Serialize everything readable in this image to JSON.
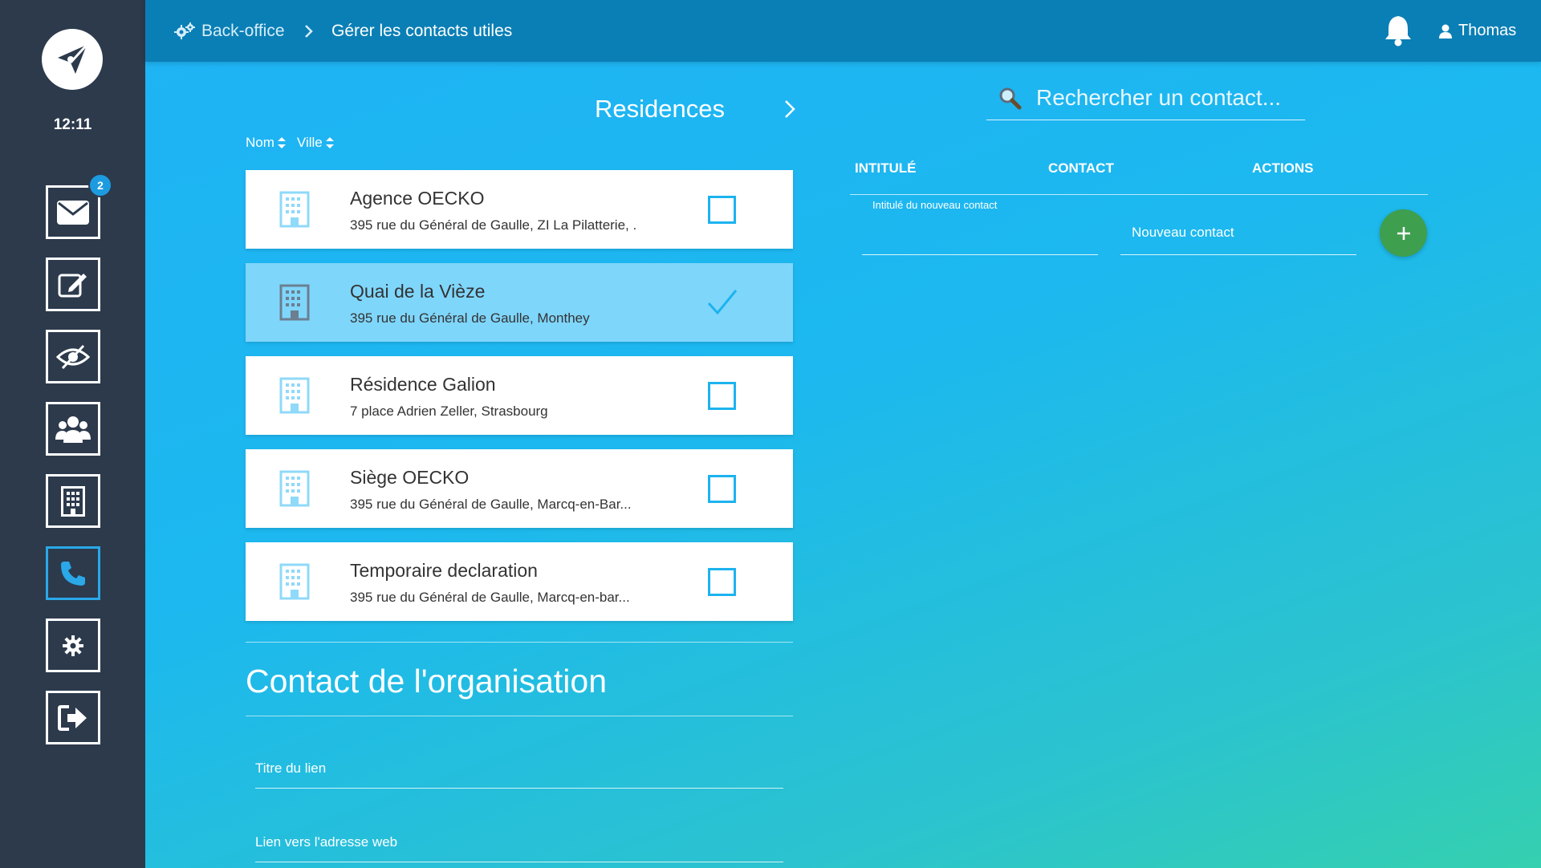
{
  "sidebar": {
    "time": "12:11",
    "mail_badge": "2",
    "items": [
      {
        "name": "mail",
        "icon": "envelope-icon"
      },
      {
        "name": "edit",
        "icon": "edit-icon"
      },
      {
        "name": "visibility",
        "icon": "eye-slash-icon"
      },
      {
        "name": "users",
        "icon": "users-icon"
      },
      {
        "name": "building",
        "icon": "building-icon"
      },
      {
        "name": "phone",
        "icon": "phone-icon",
        "active": true
      },
      {
        "name": "settings",
        "icon": "gear-icon"
      },
      {
        "name": "logout",
        "icon": "sign-out-icon"
      }
    ]
  },
  "topbar": {
    "crumb_root": "Back-office",
    "crumb_current": "Gérer les contacts utiles",
    "user_name": "Thomas"
  },
  "residences": {
    "title": "Residences",
    "sort_name": "Nom",
    "sort_city": "Ville",
    "items": [
      {
        "name": "Agence OECKO",
        "address": "395 rue du Général de Gaulle, ZI La Pilatterie, .",
        "selected": false
      },
      {
        "name": "Quai de la Vièze",
        "address": "395 rue du Général de Gaulle, Monthey",
        "selected": true
      },
      {
        "name": "Résidence Galion",
        "address": "7 place Adrien Zeller, Strasbourg",
        "selected": false
      },
      {
        "name": "Siège OECKO",
        "address": "395 rue du Général de Gaulle, Marcq-en-Bar...",
        "selected": false
      },
      {
        "name": "Temporaire declaration",
        "address": "395 rue du Général de Gaulle, Marcq-en-bar...",
        "selected": false
      }
    ]
  },
  "organisation": {
    "title": "Contact de l'organisation",
    "link_title_label": "Titre du lien",
    "link_url_label": "Lien vers l'adresse web"
  },
  "contacts": {
    "search_placeholder": "Rechercher un contact...",
    "col_title": "INTITULÉ",
    "col_contact": "CONTACT",
    "col_actions": "ACTIONS",
    "new_title_label": "Intitulé du nouveau contact",
    "new_contact_value": "Nouveau contact"
  },
  "colors": {
    "sidebar": "#2c3a4c",
    "topbar": "#0a7fb5",
    "accent": "#1cb3ee",
    "add_button": "#3e9f4f"
  }
}
